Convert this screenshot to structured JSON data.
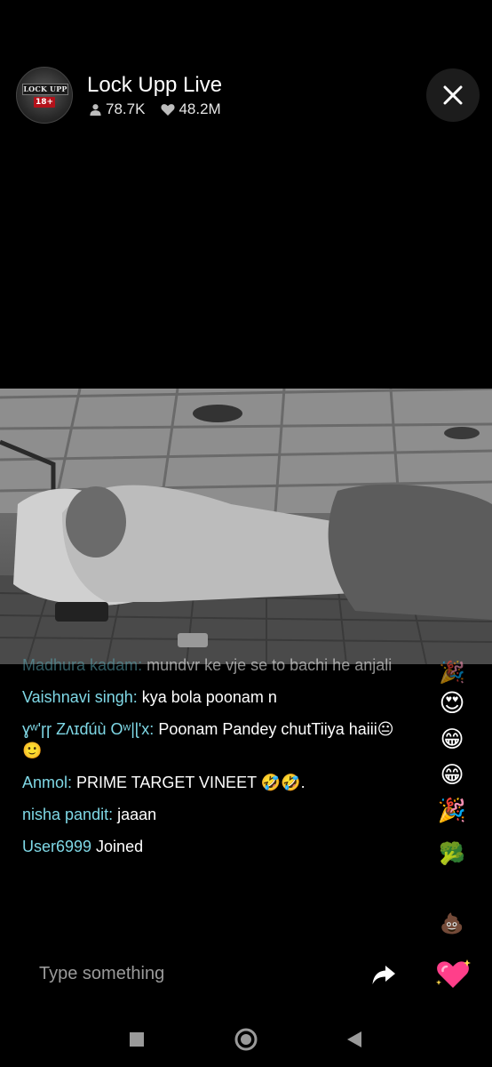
{
  "header": {
    "avatar_icon": "lock-upp-logo",
    "avatar_logo_top": "LOCK UPP",
    "avatar_logo_age": "18+",
    "title": "Lock Upp Live",
    "viewers_icon": "person-icon",
    "viewers": "78.7K",
    "likes_icon": "heart-icon",
    "likes": "48.2M",
    "close_icon": "close-icon"
  },
  "video": {
    "description_icon": "live-video-frame"
  },
  "chat": {
    "messages": [
      {
        "user": "Madhura kadam:",
        "text": " mundvr ke vje se to bachi he anjali"
      },
      {
        "user": "Vaishnavi singh:",
        "text": " kya bola poonam n"
      },
      {
        "user": "ɣʷ'ɼɼ Ζʌɪɗúù Oʷ|ɭ'x:",
        "text": " Poonam Pandey chutTiiya haiii😐🙂"
      },
      {
        "user": "Anmol:",
        "text": " PRIME TARGET VINEET 🤣🤣."
      },
      {
        "user": "nisha pandit:",
        "text": " jaaan"
      },
      {
        "user": "User6999",
        "text": " Joined"
      }
    ]
  },
  "reactions": [
    "🎉",
    "😍",
    "😁",
    "😁",
    "🎉",
    "🥦",
    "💩"
  ],
  "input": {
    "placeholder": "Type something",
    "share_icon": "share-arrow-icon",
    "heart_icon": "sparkling-heart-icon",
    "accent_color": "#7fd8e6"
  },
  "navbar": {
    "recent_icon": "square-recents-icon",
    "home_icon": "circle-home-icon",
    "back_icon": "triangle-back-icon"
  }
}
